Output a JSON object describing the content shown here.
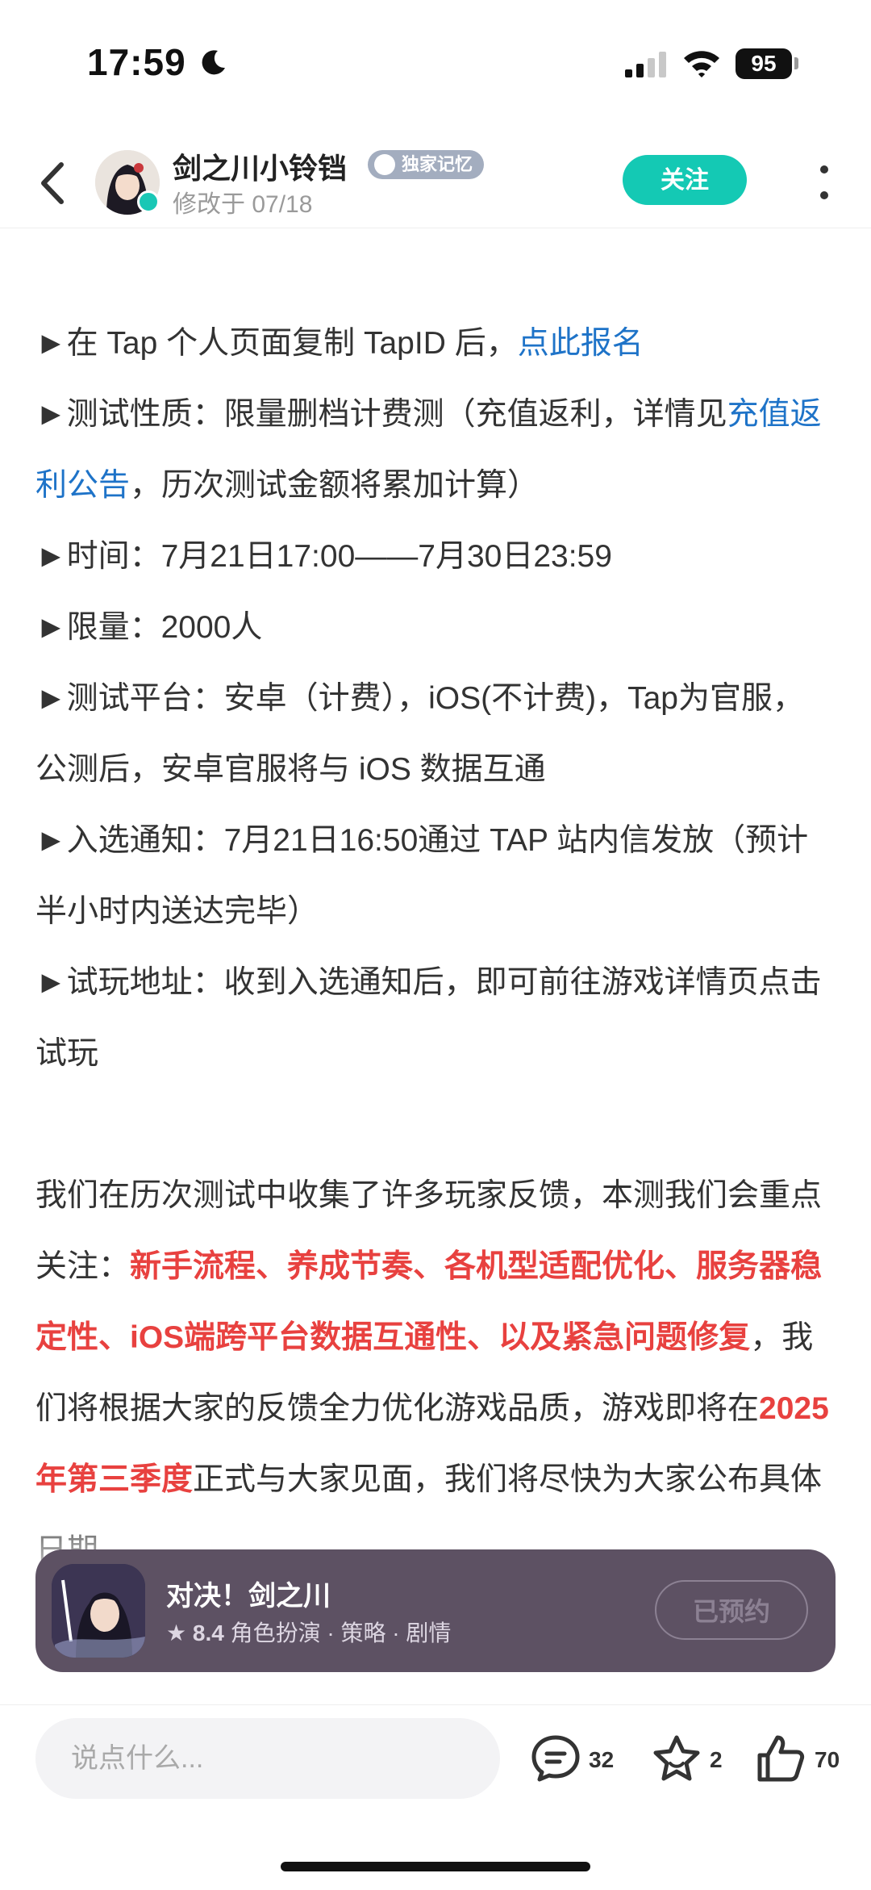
{
  "status_bar": {
    "time": "17:59",
    "battery": "95"
  },
  "header": {
    "author": "剑之川小铃铛",
    "badge": "独家记忆",
    "modified": "修改于 07/18",
    "follow_label": "关注"
  },
  "article": {
    "line1_a": "►在 Tap 个人页面复制 TapID 后，",
    "line1_link": "点此报名",
    "line2_a": "►测试性质：限量删档计费测（充值返利，详情见",
    "line2_link": "充值返利公告",
    "line2_b": "，历次测试金额将累加计算）",
    "line3": "►时间：7月21日17:00——7月30日23:59",
    "line4": "►限量：2000人",
    "line5": "►测试平台：安卓（计费），iOS(不计费)，Tap为官服，公测后，安卓官服将与 iOS 数据互通",
    "line6": "►入选通知：7月21日16:50通过 TAP 站内信发放（预计半小时内送达完毕）",
    "line7": "►试玩地址：收到入选通知后，即可前往游戏详情页点击试玩",
    "para_a": "我们在历次测试中收集了许多玩家反馈，本测我们会重点关注：",
    "para_red1": "新手流程、养成节奏、各机型适配优化、服务器稳定性、iOS端跨平台数据互通性、以及紧急问题修复",
    "para_b": "，我们将根据大家的反馈全力优化游戏品质，游戏即将在",
    "para_red2": "2025年第三季度",
    "para_c": "正式与大家见面，我们将尽快为大家公布具体日期"
  },
  "game_card": {
    "title": "对决！剑之川",
    "rating": "8.4",
    "tags": "角色扮演 · 策略 · 剧情",
    "reserve_label": "已预约"
  },
  "bottom_bar": {
    "input_placeholder": "说点什么...",
    "comments": "32",
    "favorites": "2",
    "likes": "70"
  },
  "colors": {
    "accent": "#14c9b4",
    "link": "#1e73c8",
    "highlight": "#e8413f",
    "card_bg": "#5d5163"
  }
}
